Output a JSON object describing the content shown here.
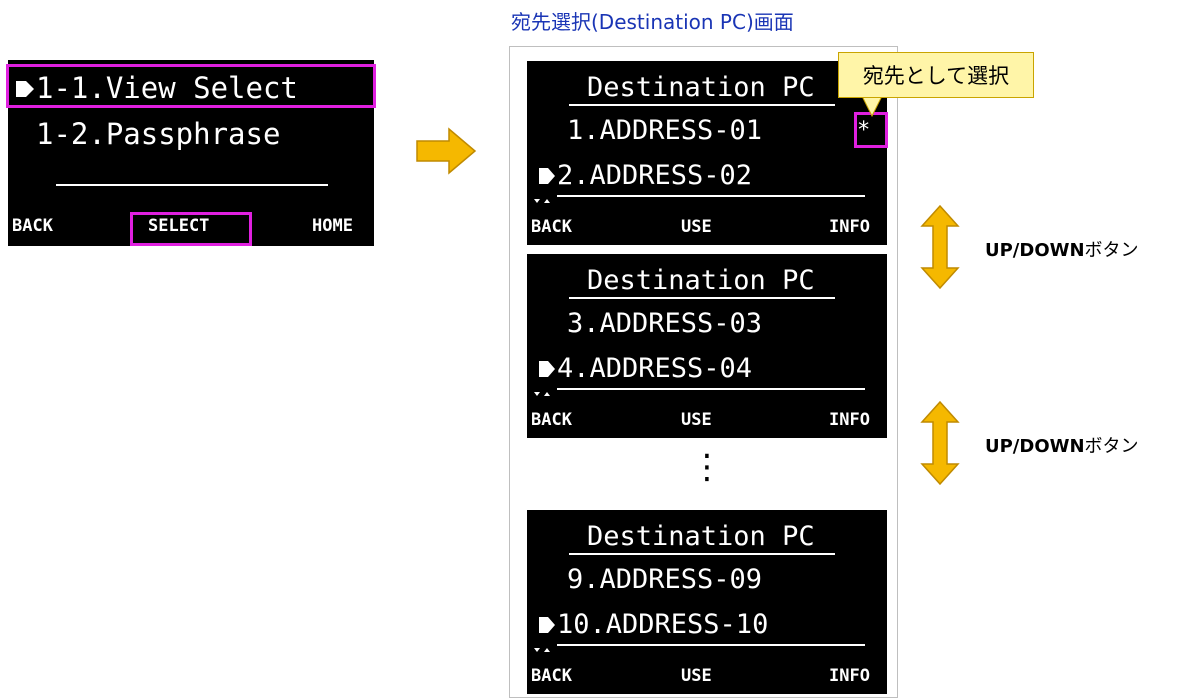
{
  "menu": {
    "item1": "1-1.View Select",
    "item2": "1-2.Passphrase",
    "softkeys": {
      "left": "BACK",
      "center": "SELECT",
      "right": "HOME"
    }
  },
  "caption": "宛先選択(Destination PC)画面",
  "callout": "宛先として選択",
  "selected_marker": "*",
  "screens": [
    {
      "title": "Destination PC",
      "line1": "1.ADDRESS-01",
      "line2": "2.ADDRESS-02",
      "softkeys": {
        "left": "BACK",
        "center": "USE",
        "right": "INFO"
      }
    },
    {
      "title": "Destination PC",
      "line1": "3.ADDRESS-03",
      "line2": "4.ADDRESS-04",
      "softkeys": {
        "left": "BACK",
        "center": "USE",
        "right": "INFO"
      }
    },
    {
      "title": "Destination PC",
      "line1": "9.ADDRESS-09",
      "line2": "10.ADDRESS-10",
      "softkeys": {
        "left": "BACK",
        "center": "USE",
        "right": "INFO"
      }
    }
  ],
  "ellipsis": "⋮",
  "updown": [
    {
      "bold": "UP/DOWN",
      "suffix": "ボタン"
    },
    {
      "bold": "UP/DOWN",
      "suffix": "ボタン"
    }
  ],
  "colors": {
    "highlight": "#e020e0",
    "arrow": "#f5b800",
    "caption": "#1a35b5",
    "callout_bg": "#fff5a8"
  }
}
